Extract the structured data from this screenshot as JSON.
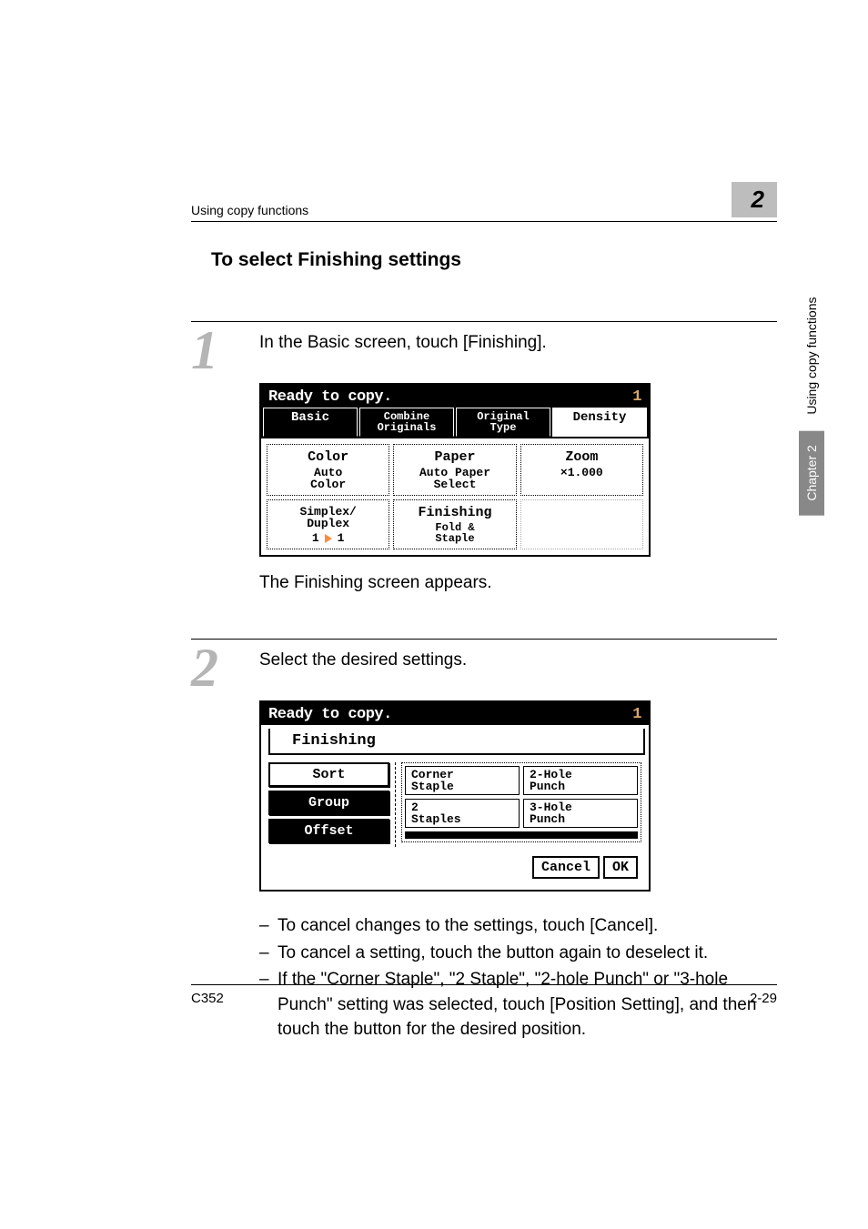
{
  "header": {
    "left": "Using copy functions",
    "chapter_number": "2"
  },
  "section_title": "To select Finishing settings",
  "side": {
    "chapter_label": "Chapter 2",
    "section_label": "Using copy functions"
  },
  "step1": {
    "number": "1",
    "text": "In the Basic screen, touch [Finishing].",
    "after_text": "The Finishing screen appears.",
    "lcd": {
      "status": "Ready to copy.",
      "copies": "1",
      "tabs": {
        "basic": "Basic",
        "combine": "Combine\nOriginals",
        "original": "Original\nType",
        "density": "Density"
      },
      "cells": {
        "color_label": "Color",
        "color_value": "Auto\nColor",
        "paper_label": "Paper",
        "paper_value": "Auto Paper\nSelect",
        "zoom_label": "Zoom",
        "zoom_value": "×1.000",
        "simplex_label": "Simplex/\nDuplex",
        "simplex_value_left": "1",
        "simplex_value_right": "1",
        "finishing_label": "Finishing",
        "finishing_value": "Fold &\nStaple"
      }
    }
  },
  "step2": {
    "number": "2",
    "text": "Select the desired settings.",
    "lcd": {
      "status": "Ready to copy.",
      "copies": "1",
      "tab": "Finishing",
      "left_buttons": {
        "sort": "Sort",
        "group": "Group",
        "offset": "Offset"
      },
      "right_buttons": {
        "corner": "Corner\nStaple",
        "two_hole": "2-Hole\nPunch",
        "two_staple": "2\nStaples",
        "three_hole": "3-Hole\nPunch"
      },
      "cancel": "Cancel",
      "ok": "OK"
    },
    "bullets": {
      "b1": "To cancel changes to the settings, touch [Cancel].",
      "b2": "To cancel a setting, touch the button again to deselect it.",
      "b3": "If the \"Corner Staple\", \"2 Staple\", \"2-hole Punch\" or \"3-hole Punch\" setting was selected, touch [Position Setting], and then touch the button for the desired position."
    }
  },
  "footer": {
    "left": "C352",
    "right": "2-29"
  }
}
